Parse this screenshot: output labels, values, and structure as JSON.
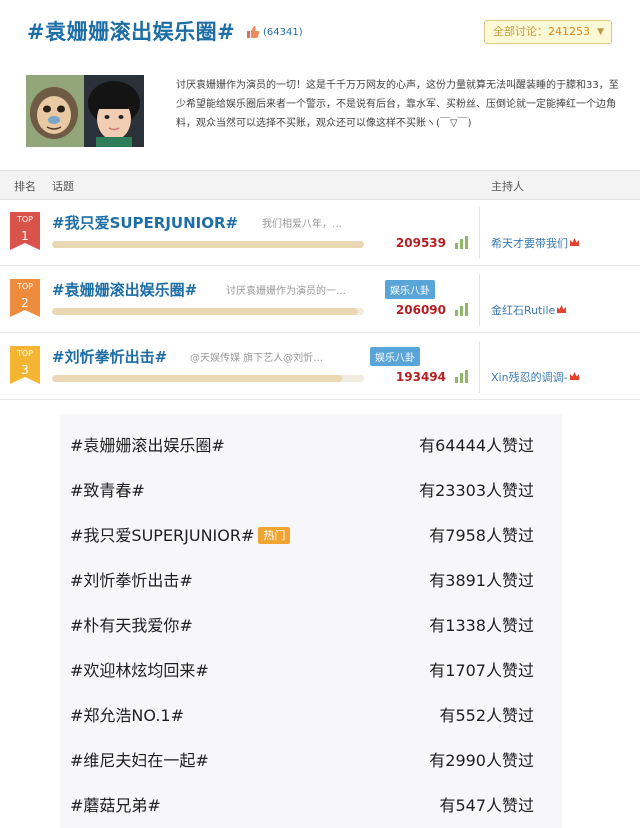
{
  "header": {
    "title": "#袁姗姗滚出娱乐圈#",
    "likes": "(64341)",
    "discuss_label": "全部讨论：",
    "discuss_value": "241253"
  },
  "intro": {
    "text": "讨厌袁姗姗作为演员的一切！这是千千万万网友的心声，这份力量就算无法叫醒装睡的于朦和33，至少希望能给娱乐圈后来者一个警示，不是说有后台，靠水军、买粉丝、压倒论就一定能捧红一个边角料，观众当然可以选择不买账，观众还可以像这样不买账ヽ(￣▽￣)"
  },
  "table_header": {
    "rank": "排名",
    "topic": "话题",
    "host": "主持人"
  },
  "rankings": [
    {
      "flag_label": "TOP",
      "rank": "1",
      "flag_color": "#d9534a",
      "name": "#我只爱SUPERJUNIOR#",
      "desc": "我们相爱八年，…",
      "category": "",
      "count": "209539",
      "progress": 1.0,
      "host": "希天才要带我们"
    },
    {
      "flag_label": "TOP",
      "rank": "2",
      "flag_color": "#ef8b3c",
      "name": "#袁姗姗滚出娱乐圈#",
      "desc": "讨厌袁姗姗作为演员的一…",
      "category": "娱乐八卦",
      "count": "206090",
      "progress": 0.98,
      "host": "金红石Rutile"
    },
    {
      "flag_label": "TOP",
      "rank": "3",
      "flag_color": "#f4b632",
      "name": "#刘忻拳忻出击#",
      "desc": "@天娱传媒 旗下艺人@刘忻…",
      "category": "娱乐八卦",
      "count": "193494",
      "progress": 0.93,
      "host": "Xin残忍的调调-"
    }
  ],
  "tag_list": [
    {
      "name": "#袁姗姗滚出娱乐圈#",
      "hot": "",
      "count": "有64444人赞过"
    },
    {
      "name": "#致青春#",
      "hot": "",
      "count": "有23303人赞过"
    },
    {
      "name": "#我只爱SUPERJUNIOR#",
      "hot": "热门",
      "count": "有7958人赞过"
    },
    {
      "name": "#刘忻拳忻出击#",
      "hot": "",
      "count": "有3891人赞过"
    },
    {
      "name": "#朴有天我爱你#",
      "hot": "",
      "count": "有1338人赞过"
    },
    {
      "name": "#欢迎林炫均回来#",
      "hot": "",
      "count": "有1707人赞过"
    },
    {
      "name": "#郑允浩NO.1#",
      "hot": "",
      "count": "有552人赞过"
    },
    {
      "name": "#维尼夫妇在一起#",
      "hot": "",
      "count": "有2990人赞过"
    },
    {
      "name": "#蘑菇兄弟#",
      "hot": "",
      "count": "有547人赞过"
    }
  ],
  "colors": {
    "title_blue": "#1e6ea6",
    "count_red": "#b52024",
    "hot_orange": "#f0a431",
    "category_blue": "#5aa5d8"
  },
  "icons": {
    "like": "thumbs-up-icon",
    "chart": "bar-chart-icon",
    "host": "crown-icon"
  }
}
